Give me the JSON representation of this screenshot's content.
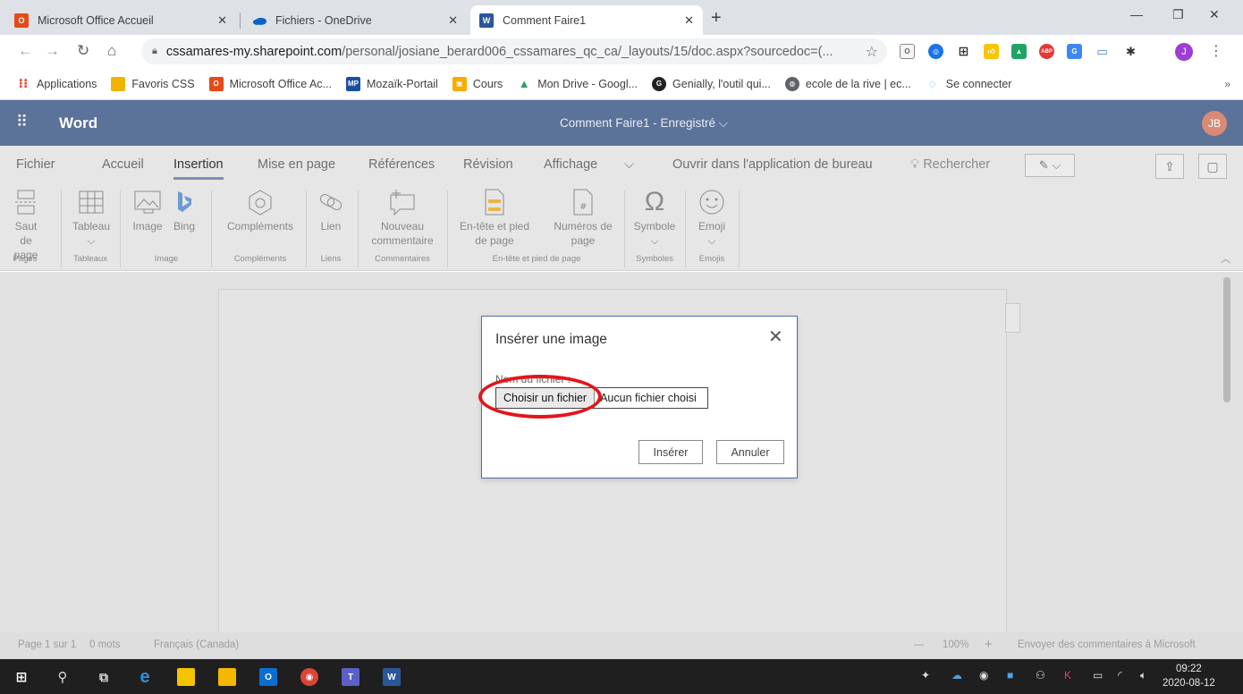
{
  "browser": {
    "tabs": [
      {
        "title": "Microsoft Office Accueil",
        "icon": "office-icon",
        "color": "#e64a19"
      },
      {
        "title": "Fichiers - OneDrive",
        "icon": "onedrive-icon",
        "color": "#0a64c8"
      },
      {
        "title": "Comment Faire1",
        "icon": "word-icon",
        "color": "#2b579a",
        "active": true
      }
    ],
    "close_glyph": "✕",
    "new_tab_glyph": "+",
    "url_host": "cssamares-my.sharepoint.com",
    "url_path": "/personal/josiane_berard006_cssamares_qc_ca/_layouts/15/doc.aspx?sourcedoc=(...",
    "profile_initial": "J",
    "bookmarks": [
      {
        "label": "Applications",
        "icon": "apps-grid-icon",
        "color": "#ea4335"
      },
      {
        "label": "Favoris CSS",
        "icon": "folder-icon",
        "color": "#f2b200"
      },
      {
        "label": "Microsoft Office Ac...",
        "icon": "office-icon",
        "color": "#e64a19"
      },
      {
        "label": "Mozaïk-Portail",
        "icon": "mozaik-icon",
        "color": "#1a4fa0"
      },
      {
        "label": "Cours",
        "icon": "classroom-icon",
        "color": "#f9ab00"
      },
      {
        "label": "Mon Drive - Googl...",
        "icon": "drive-icon",
        "color": "#1fa463"
      },
      {
        "label": "Genially, l'outil qui...",
        "icon": "genially-icon",
        "color": "#222222"
      },
      {
        "label": "ecole de la rive | ec...",
        "icon": "globe-icon",
        "color": "#5f6368"
      },
      {
        "label": "Se connecter",
        "icon": "swirl-icon",
        "color": "#3ab0d8"
      }
    ],
    "bookmarks_more": "»"
  },
  "word": {
    "app_name": "Word",
    "doc_title": "Comment Faire1  -  Enregistré ⌵",
    "user_initials": "JB",
    "menu_tabs": [
      "Fichier",
      "Accueil",
      "Insertion",
      "Mise en page",
      "Références",
      "Révision",
      "Affichage",
      "⌵",
      "Ouvrir dans l'application de bureau"
    ],
    "search_label": "Rechercher",
    "commands": [
      {
        "label": "Saut de page",
        "icon": "page-break-icon"
      },
      {
        "label": "Tableau",
        "icon": "table-icon",
        "chevron": "⌵"
      },
      {
        "label": "Image",
        "icon": "image-icon"
      },
      {
        "label": "Bing",
        "icon": "bing-icon"
      },
      {
        "label": "Compléments",
        "icon": "addins-icon"
      },
      {
        "label": "Lien",
        "icon": "link-icon"
      },
      {
        "label": "Nouveau commentaire",
        "icon": "comment-icon"
      },
      {
        "label": "En-tête et pied de page",
        "icon": "header-footer-icon"
      },
      {
        "label": "Numéros de page",
        "icon": "page-number-icon",
        "chevron": "⌵"
      },
      {
        "label": "Symbole",
        "icon": "omega-icon",
        "chevron": "⌵"
      },
      {
        "label": "Emoji",
        "icon": "emoji-icon",
        "chevron": "⌵"
      }
    ],
    "groups": [
      "Pages",
      "Tableaux",
      "Image",
      "Compléments",
      "Liens",
      "Commentaires",
      "En-tête et pied de page",
      "Symboles",
      "Emojis"
    ],
    "status": {
      "page": "Page 1 sur 1",
      "words": "0 mots",
      "language": "Français (Canada)",
      "zoom": "100%",
      "zoom_minus": "—",
      "zoom_plus": "+",
      "feedback": "Envoyer des commentaires à Microsoft"
    }
  },
  "dialog": {
    "title": "Insérer une image",
    "field_label": "Nom du fichier :",
    "choose_button": "Choisir un fichier",
    "no_file": "Aucun fichier choisi",
    "insert_button": "Insérer",
    "cancel_button": "Annuler",
    "highlight_color": "#e2151b"
  },
  "taskbar": {
    "time": "09:22",
    "date": "2020-08-12"
  }
}
